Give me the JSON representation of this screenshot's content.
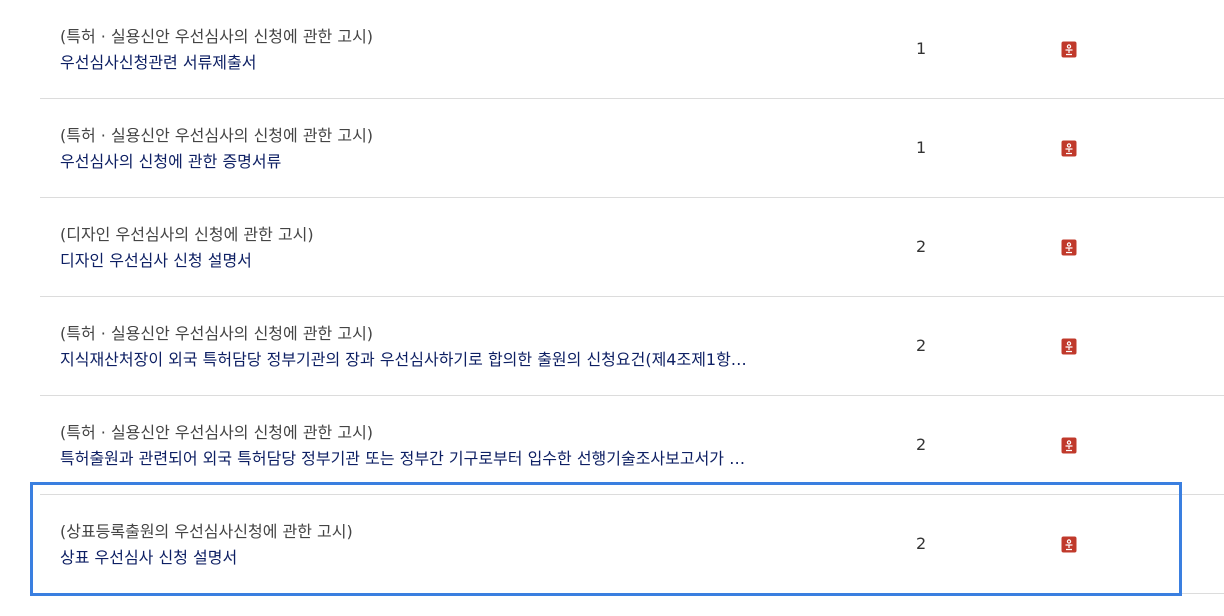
{
  "rows": [
    {
      "subtitle": "(특허 · 실용신안 우선심사의 신청에 관한 고시)",
      "title": "우선심사신청관련 서류제출서",
      "count": "1"
    },
    {
      "subtitle": "(특허 · 실용신안 우선심사의 신청에 관한 고시)",
      "title": "우선심사의 신청에 관한 증명서류",
      "count": "1"
    },
    {
      "subtitle": "(디자인 우선심사의 신청에 관한 고시)",
      "title": "디자인 우선심사 신청 설명서",
      "count": "2"
    },
    {
      "subtitle": "(특허 · 실용신안 우선심사의 신청에 관한 고시)",
      "title": "지식재산처장이 외국 특허담당 정부기관의 장과 우선심사하기로 합의한 출원의 신청요건(제4조제1항…",
      "count": "2"
    },
    {
      "subtitle": "(특허 · 실용신안 우선심사의 신청에 관한 고시)",
      "title": "특허출원과 관련되어 외국 특허담당 정부기관 또는 정부간 기구로부터 입수한 선행기술조사보고서가 …",
      "count": "2"
    },
    {
      "subtitle": "(상표등록출원의 우선심사신청에 관한 고시)",
      "title": "상표 우선심사 신청 설명서",
      "count": "2"
    }
  ],
  "icon": "hwp-file-icon",
  "colors": {
    "link": "#0d1f63",
    "icon": "#c0392b",
    "highlight": "#3a7fe0"
  }
}
